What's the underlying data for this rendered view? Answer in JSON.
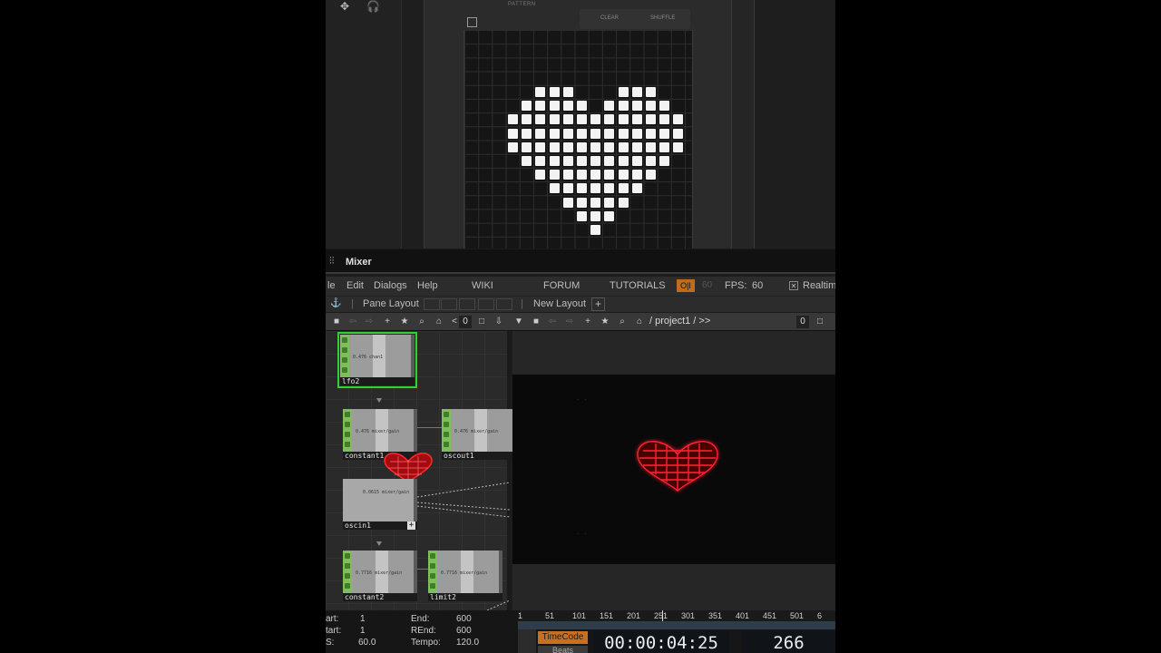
{
  "top_toolbar": {
    "move_icon": "move-icon",
    "headphones_icon": "headphones-icon"
  },
  "device": {
    "tabs": [
      "PATTERN"
    ],
    "buttons": [
      "CLEAR",
      "SHUFFLE"
    ],
    "heart_rows": [
      "..XXX...XXX..",
      ".XXXXX.XXXXX.",
      "XXXXXXXXXXXXX",
      "XXXXXXXXXXXXX",
      "XXXXXXXXXXXXX",
      ".XXXXXXXXXXX.",
      "..XXXXXXXXX..",
      "...XXXXXXX...",
      "....XXXXX....",
      ".....XXX.....",
      "......X......"
    ]
  },
  "mixer": {
    "title": "Mixer"
  },
  "menu": {
    "items": [
      "le",
      "Edit",
      "Dialogs",
      "Help"
    ],
    "links": [
      "WIKI",
      "FORUM",
      "TUTORIALS"
    ],
    "oi_badge": "O|I",
    "fps_dim": "60",
    "fps_label": "FPS:",
    "fps_value": "60",
    "realtime_label": "Realtim"
  },
  "pane": {
    "pane_layout": "Pane Layout",
    "new_layout": "New Layout",
    "plus": "+"
  },
  "path": {
    "left_index": "0",
    "text": "/ project1 / >>",
    "right_index": "0"
  },
  "network": {
    "nodes": [
      {
        "name": "lfo2",
        "value": "0.476 chan1"
      },
      {
        "name": "constant1",
        "value": "0.476 mixer/gain"
      },
      {
        "name": "oscout1",
        "value": "0.476 mixer/gain"
      },
      {
        "name": "oscin1",
        "value": "0.0615 mixer/gain"
      },
      {
        "name": "constant2",
        "value": "0.7716 mixer/gain"
      },
      {
        "name": "limit2",
        "value": "0.7716 mixer/gain"
      }
    ],
    "plus": "+"
  },
  "timeline": {
    "start_label": "art:",
    "start_value": "1",
    "rstart_label": "tart:",
    "rstart_value": "1",
    "fps_label": "S:",
    "fps_value": "60.0",
    "end_label": "End:",
    "end_value": "600",
    "rend_label": "REnd:",
    "rend_value": "600",
    "tempo_label": "Tempo:",
    "tempo_value": "120.0",
    "ticks": [
      "1",
      "51",
      "101",
      "151",
      "201",
      "251",
      "301",
      "351",
      "401",
      "451",
      "501",
      "6"
    ],
    "timecode_label": "TimeCode",
    "beats_label": "Beats",
    "timecode": "00:00:04:25",
    "frame": "266"
  },
  "colors": {
    "accent_orange": "#c96f22",
    "node_green": "#7fbf5a",
    "selection_green": "#31d131",
    "heart_red": "#e01020"
  }
}
